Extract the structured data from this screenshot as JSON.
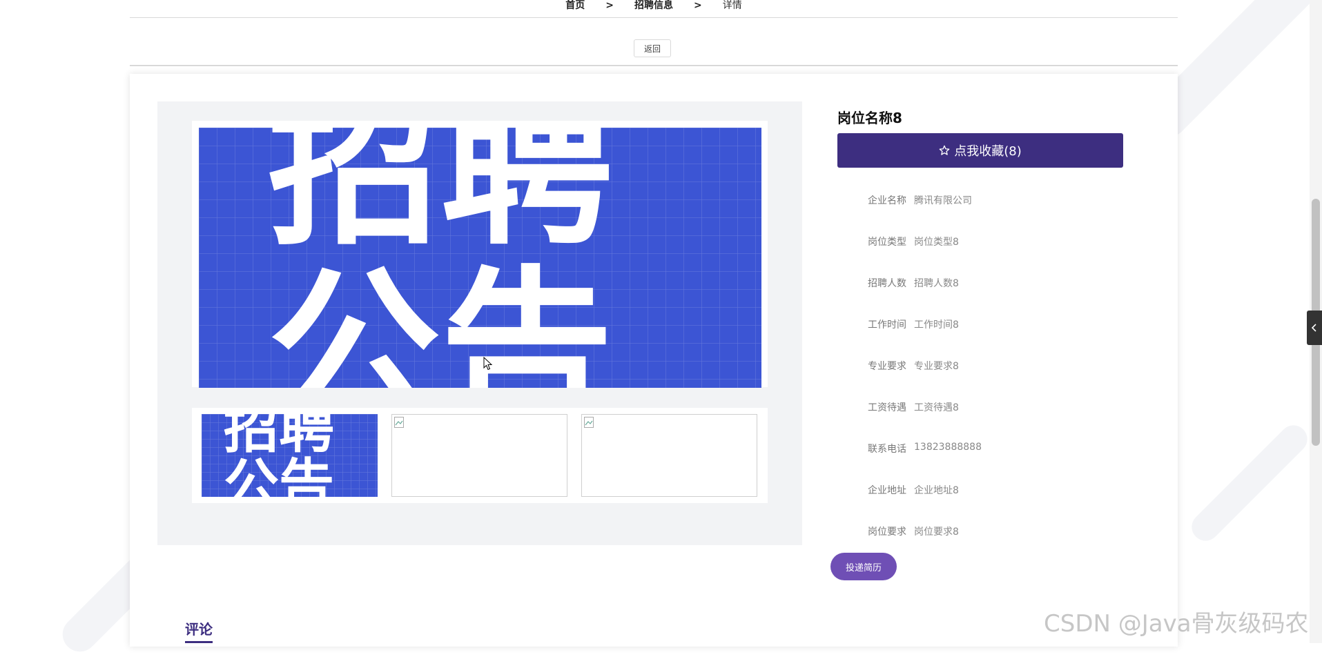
{
  "breadcrumb": {
    "home": "首页",
    "separator": ">",
    "section": "招聘信息",
    "current": "详情"
  },
  "back_label": "返回",
  "gallery": {
    "poster_text_line1": "招聘",
    "poster_text_line2": "公告",
    "poster_color": "#3c55d4"
  },
  "job": {
    "title": "岗位名称8",
    "favorite_label": "点我收藏(8)",
    "fields": [
      {
        "label": "企业名称",
        "value": "腾讯有限公司"
      },
      {
        "label": "岗位类型",
        "value": "岗位类型8"
      },
      {
        "label": "招聘人数",
        "value": "招聘人数8"
      },
      {
        "label": "工作时间",
        "value": "工作时间8"
      },
      {
        "label": "专业要求",
        "value": "专业要求8"
      },
      {
        "label": "工资待遇",
        "value": "工资待遇8"
      },
      {
        "label": "联系电话",
        "value": "13823888888"
      },
      {
        "label": "企业地址",
        "value": "企业地址8"
      },
      {
        "label": "岗位要求",
        "value": "岗位要求8"
      }
    ],
    "submit_label": "投递简历"
  },
  "comments": {
    "title": "评论"
  },
  "watermark": "CSDN @Java骨灰级码农",
  "colors": {
    "primary": "#3d2e80",
    "submit": "#6f4fb5"
  }
}
